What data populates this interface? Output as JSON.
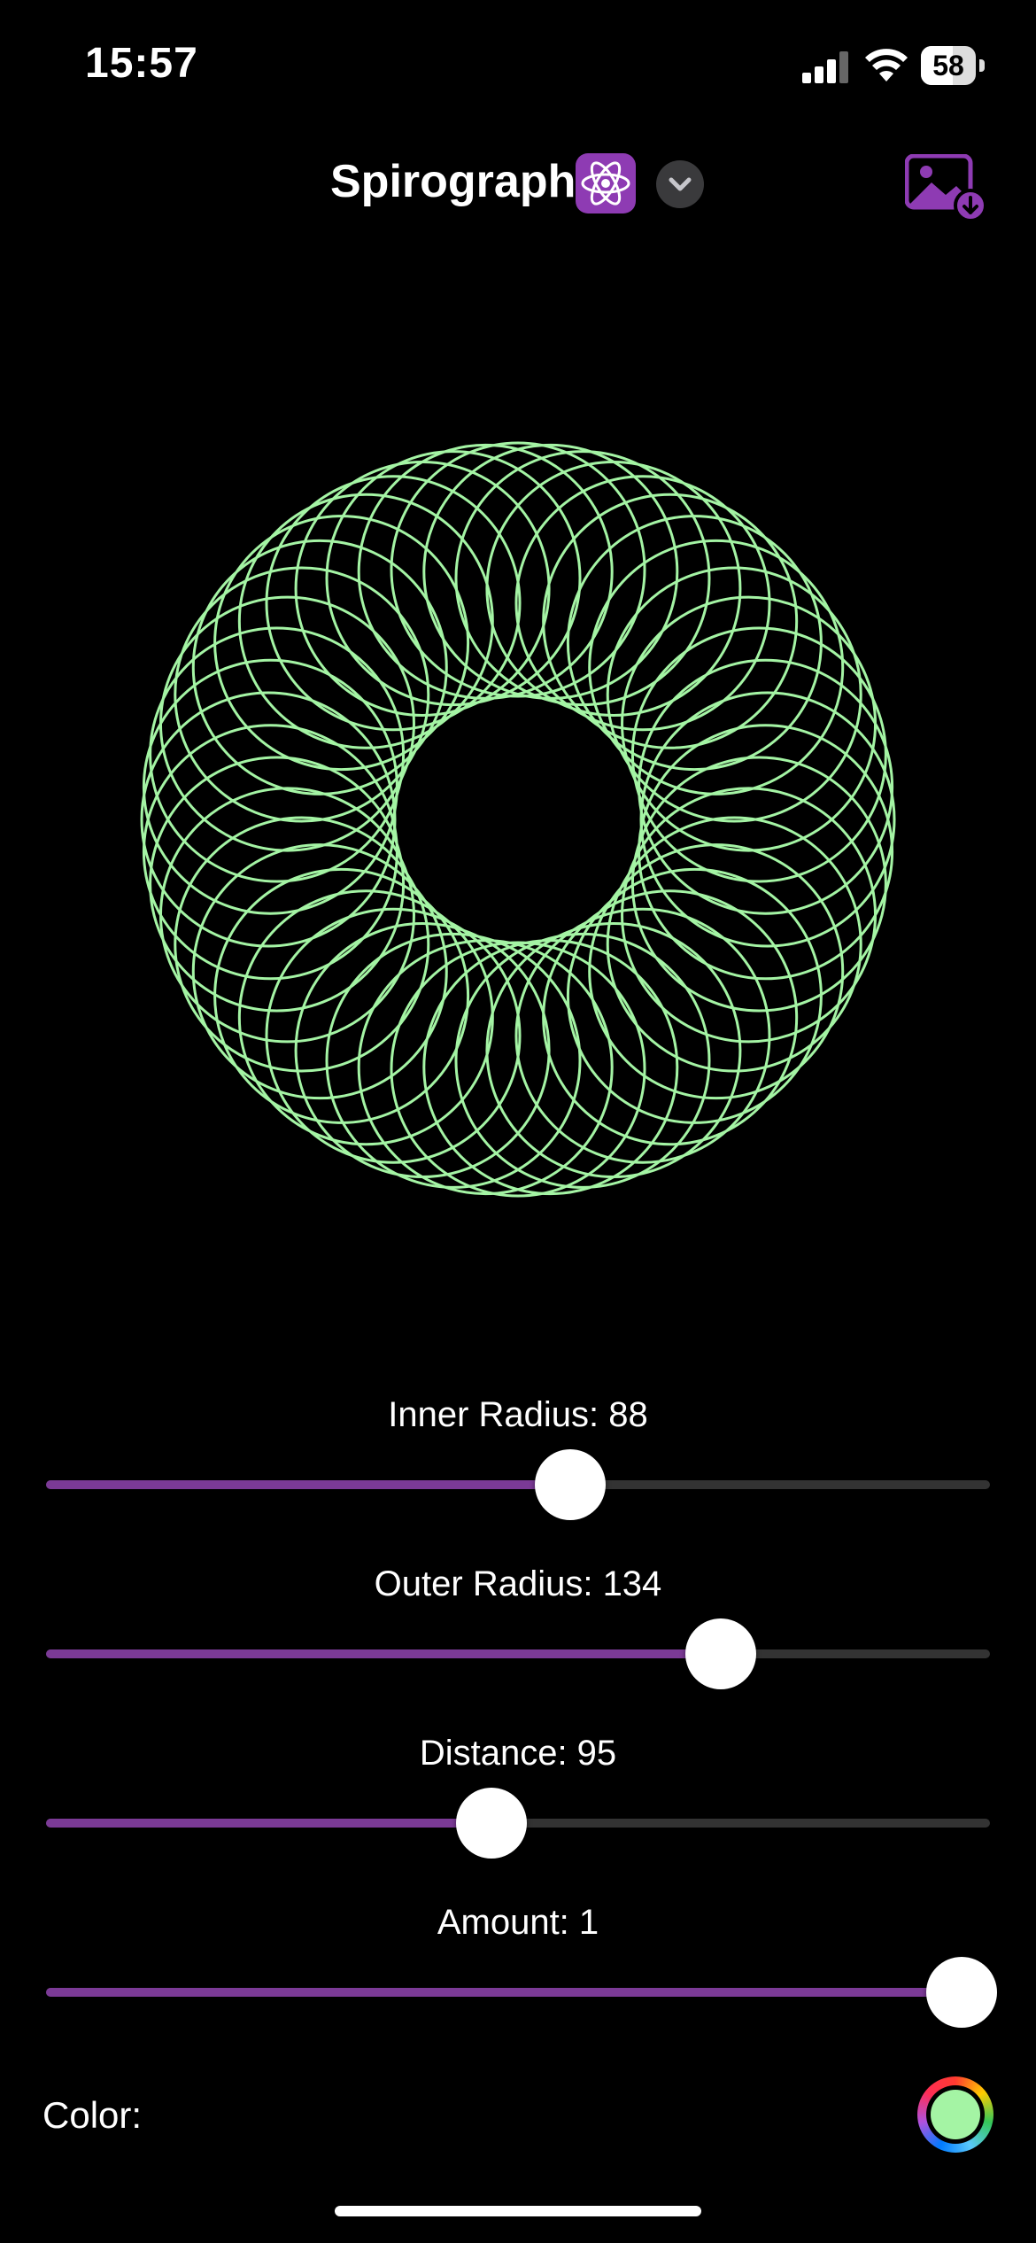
{
  "status_bar": {
    "time": "15:57",
    "battery": "58"
  },
  "nav": {
    "title": "Spirograph",
    "title_icon": "atom-icon",
    "menu_icon": "chevron-down-icon",
    "export_icon": "photo-download-icon"
  },
  "accent_color": "#7b3a96",
  "drawing": {
    "stroke_color": "#a4f4a4",
    "background": "#000000"
  },
  "sliders": [
    {
      "label": "Inner Radius: 88",
      "value": 88,
      "fraction": 0.555
    },
    {
      "label": "Outer Radius: 134",
      "value": 134,
      "fraction": 0.715
    },
    {
      "label": "Distance: 95",
      "value": 95,
      "fraction": 0.472
    },
    {
      "label": "Amount: 1",
      "value": 1,
      "fraction": 1.0
    }
  ],
  "color_row": {
    "label": "Color:",
    "value": "#a4f4a4"
  }
}
